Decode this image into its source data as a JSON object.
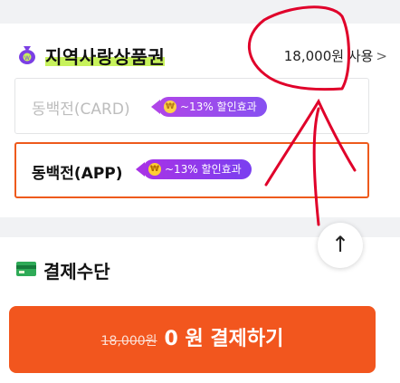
{
  "voucher": {
    "title": "지역사랑상품권",
    "usage_text": "18,000원 사용",
    "chevron": ">"
  },
  "options": [
    {
      "label": "동백전(CARD)",
      "badge": "~13% 할인효과",
      "state": "inactive"
    },
    {
      "label": "동백전(APP)",
      "badge": "~13% 할인효과",
      "state": "selected"
    }
  ],
  "payment_method": {
    "title": "결제수단"
  },
  "pay_button": {
    "original_price": "18,000원",
    "label": "0 원 결제하기"
  },
  "scroll_top": {
    "glyph": "↑"
  },
  "coin_glyph": "₩",
  "colors": {
    "accent": "#f2561e",
    "badge": "#9b38ea",
    "highlight": "#c7f25b",
    "annotation": "#e0002a"
  }
}
